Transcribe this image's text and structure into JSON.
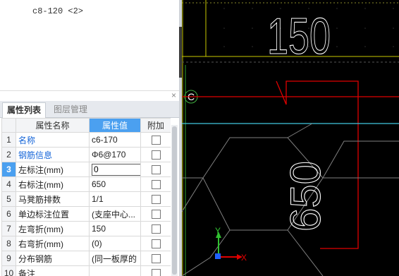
{
  "preview": {
    "text": "c8-120 <2>"
  },
  "panel": {
    "close_glyph": "×"
  },
  "tabs": [
    {
      "label": "属性列表",
      "active": true
    },
    {
      "label": "图层管理",
      "active": false
    }
  ],
  "table": {
    "columns": [
      "属性名称",
      "属性值",
      "附加"
    ],
    "rows": [
      {
        "num": "1",
        "name": "名称",
        "value": "c6-170",
        "blue": true
      },
      {
        "num": "2",
        "name": "钢筋信息",
        "value": "Φ6@170",
        "blue": true
      },
      {
        "num": "3",
        "name": "左标注(mm)",
        "value": "0",
        "editing": true
      },
      {
        "num": "4",
        "name": "右标注(mm)",
        "value": "650"
      },
      {
        "num": "5",
        "name": "马凳筋排数",
        "value": "1/1"
      },
      {
        "num": "6",
        "name": "单边标注位置",
        "value": "(支座中心..."
      },
      {
        "num": "7",
        "name": "左弯折(mm)",
        "value": "150"
      },
      {
        "num": "8",
        "name": "右弯折(mm)",
        "value": "(0)"
      },
      {
        "num": "9",
        "name": "分布钢筋",
        "value": "(同一板厚的"
      },
      {
        "num": "10",
        "name": "备注",
        "value": ""
      }
    ]
  },
  "canvas": {
    "dim_top": "150",
    "dim_side": "650",
    "axis_label": "C",
    "ucs_x": "X",
    "ucs_y": "Y",
    "colors": {
      "background": "#000000",
      "rebar": "#e00000",
      "axis": "#40c8e0",
      "dimension": "#ffffff",
      "frame": "#d8d800",
      "grid_axis": "#40b040"
    }
  }
}
